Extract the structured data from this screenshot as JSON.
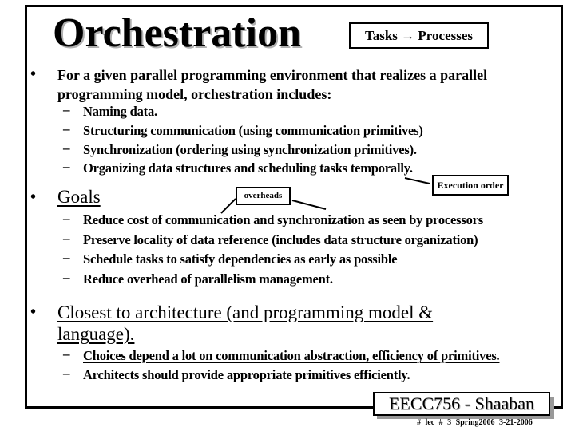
{
  "slide": {
    "title": "Orchestration",
    "tag_box": "Tasks → Processes",
    "sections": [
      {
        "bullet": "•",
        "heading_line1": "For a given parallel programming environment that realizes a parallel",
        "heading_line2": "programming model, orchestration includes:",
        "items": [
          "Naming data.",
          "Structuring communication (using communication primitives)",
          "Synchronization (ordering using synchronization primitives).",
          "Organizing data structures and scheduling tasks temporally."
        ]
      },
      {
        "bullet": "•",
        "heading": "Goals",
        "items": [
          "Reduce cost of communication and synchronization as seen by processors",
          "Preserve locality of data reference (includes data structure organization)",
          "Schedule tasks to satisfy dependencies as early as possible",
          "Reduce overhead of parallelism management."
        ]
      },
      {
        "bullet": "•",
        "heading_line1": "Closest to architecture (and programming model &",
        "heading_line2": "language).",
        "items": [
          "Choices depend a lot  on communication abstraction, efficiency of primitives.",
          "Architects should provide appropriate primitives efficiently."
        ]
      }
    ],
    "dash": "–",
    "callouts": {
      "execution_order": "Execution order",
      "overheads": "overheads"
    },
    "footer": {
      "course": "EECC756 - Shaaban",
      "meta": "#  lec # 3   Spring2006  3-21-2006"
    }
  }
}
